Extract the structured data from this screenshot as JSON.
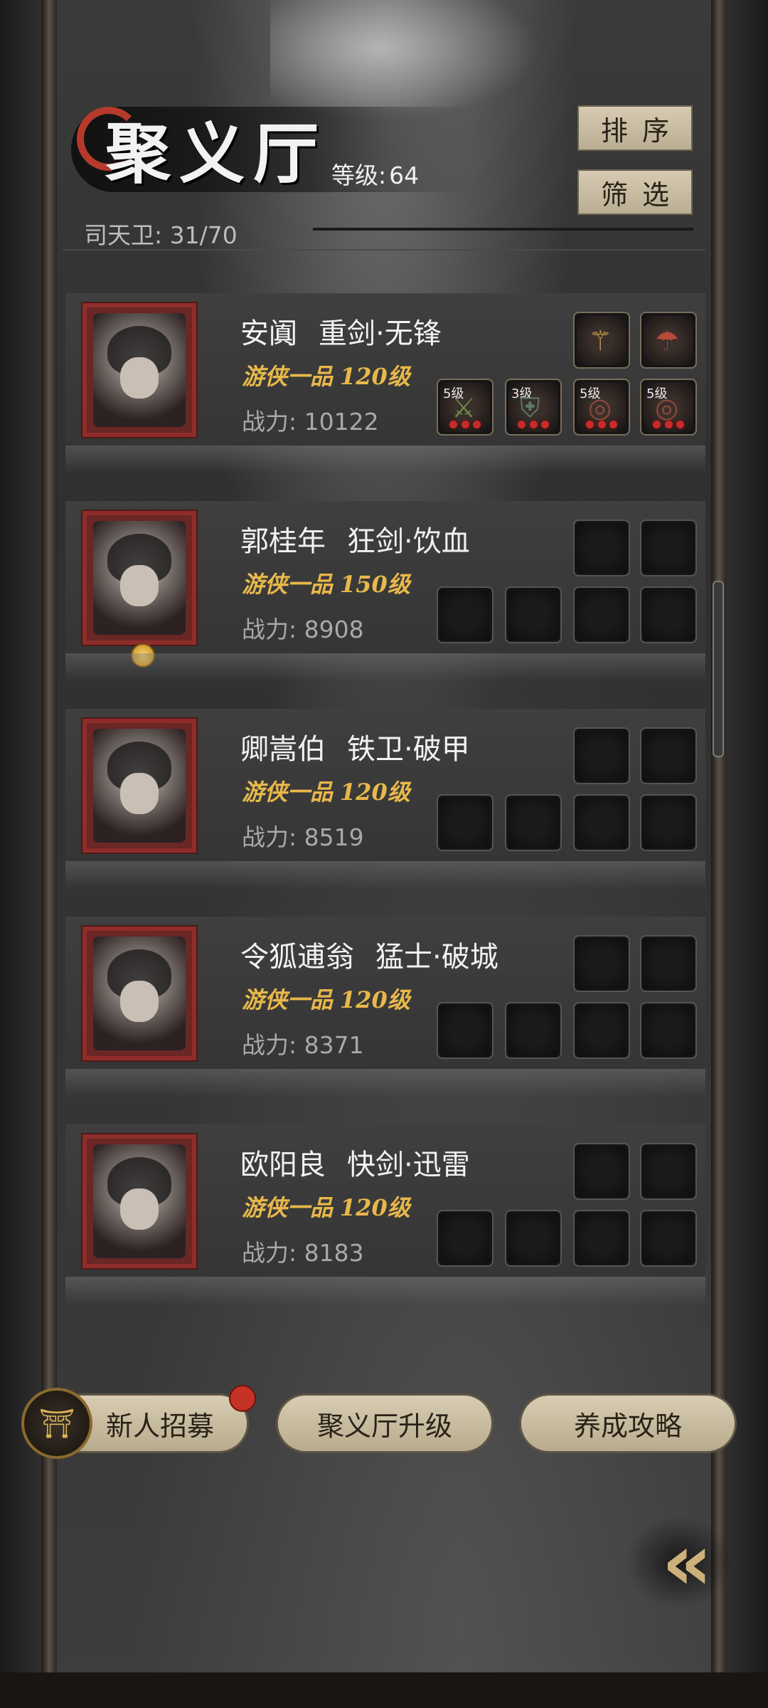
{
  "header": {
    "title": "聚义厅",
    "level_label": "等级:",
    "level_value": "64",
    "guard_label": "司天卫: 31/70",
    "sort_label": "排序",
    "filter_label": "筛选"
  },
  "heroes": [
    {
      "name": "安阗",
      "class": "重剑·无锋",
      "rank": "游侠一品",
      "level": "120级",
      "power": "战力: 10122",
      "equip_top": [
        {
          "icon": "staff-icon",
          "glyph": "⚚"
        },
        {
          "icon": "mushroom-icon",
          "glyph": "☂"
        }
      ],
      "equip_bottom": [
        {
          "level": "5级",
          "icon": "sword-icon",
          "glyph": "⚔"
        },
        {
          "level": "3级",
          "icon": "armor-icon",
          "glyph": "⛨"
        },
        {
          "level": "5级",
          "icon": "beads-icon",
          "glyph": "◎"
        },
        {
          "level": "5级",
          "icon": "beads-icon",
          "glyph": "◎"
        }
      ]
    },
    {
      "name": "郭桂年",
      "class": "狂剑·饮血",
      "rank": "游侠一品",
      "level": "150级",
      "power": "战力: 8908"
    },
    {
      "name": "卿嵩伯",
      "class": "铁卫·破甲",
      "rank": "游侠一品",
      "level": "120级",
      "power": "战力: 8519"
    },
    {
      "name": "令狐逋翁",
      "class": "猛士·破城",
      "rank": "游侠一品",
      "level": "120级",
      "power": "战力: 8371"
    },
    {
      "name": "欧阳良",
      "class": "快剑·迅雷",
      "rank": "游侠一品",
      "level": "120级",
      "power": "战力: 8183"
    }
  ],
  "footer": {
    "recruit_label": "新人招募",
    "upgrade_label": "聚义厅升级",
    "guide_label": "养成攻略",
    "back_glyph": "«"
  },
  "colors": {
    "rank_gold": "#e8b84a",
    "portrait_frame": "#8f2d2a",
    "button_beige": "#d8cdb3",
    "notify_red": "#c43224"
  }
}
